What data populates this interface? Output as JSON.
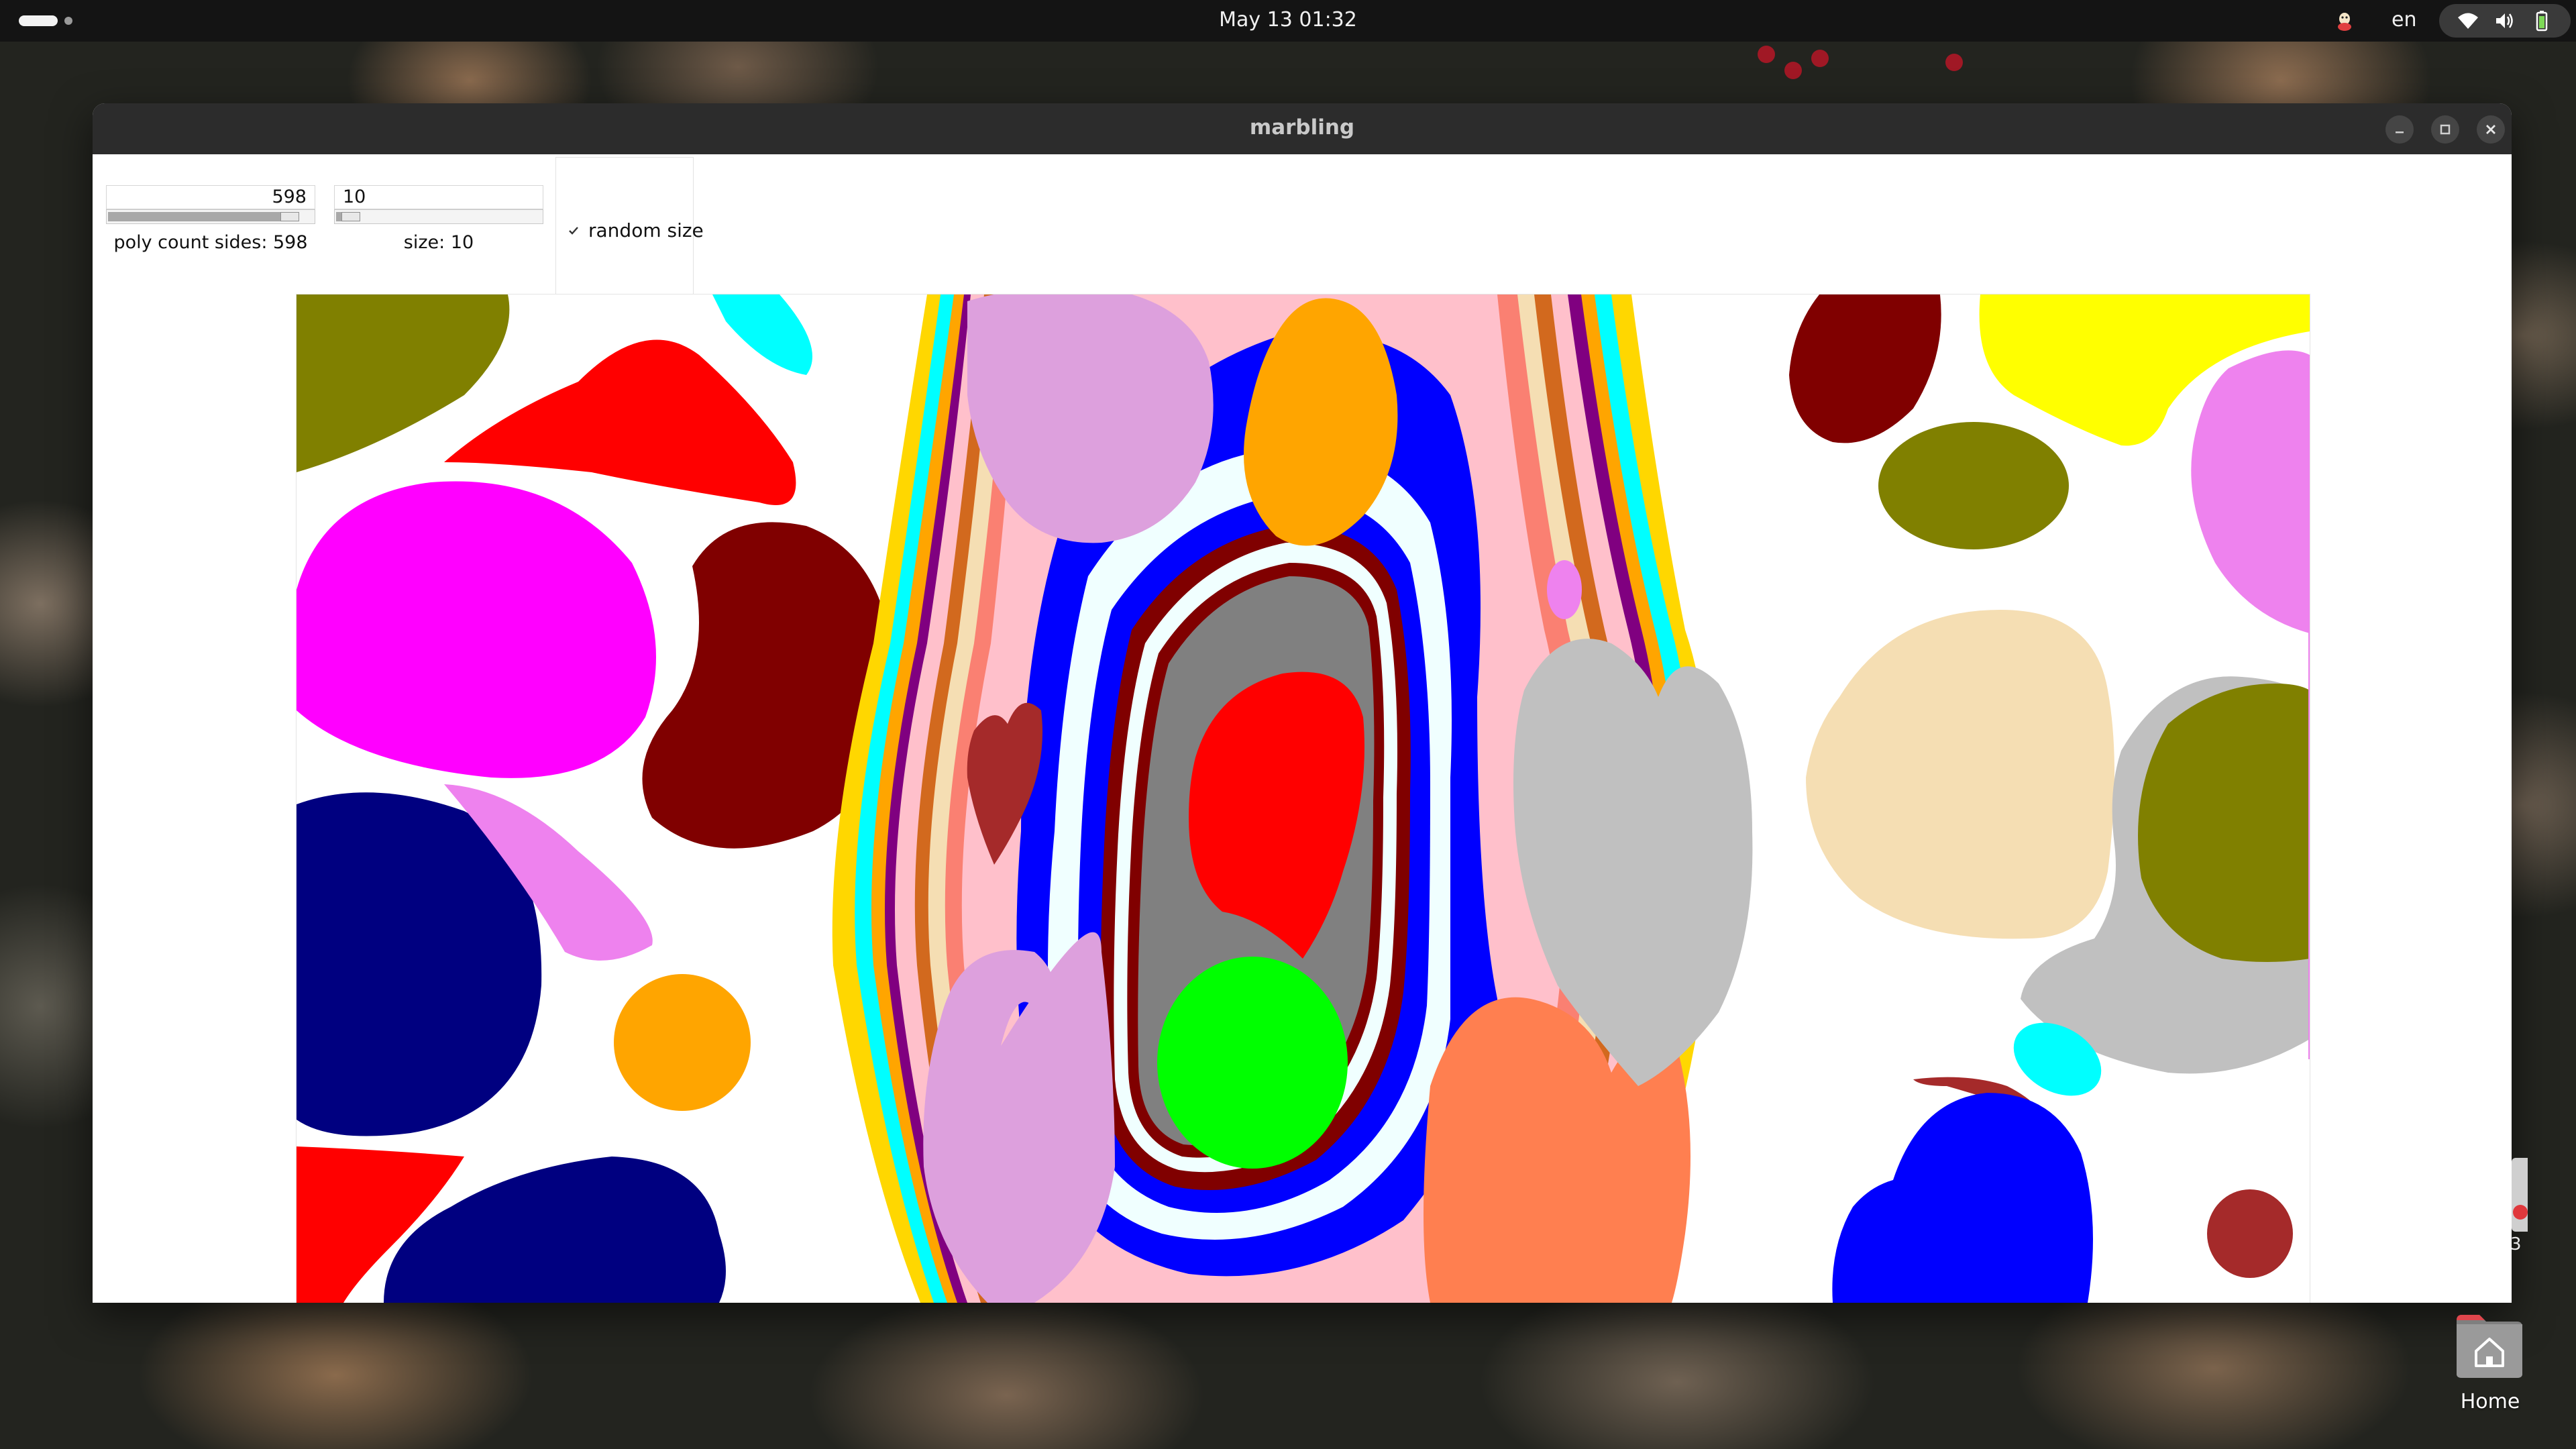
{
  "topbar": {
    "clock": "May 13  01:32",
    "language": "en",
    "icons": [
      "activities-icon",
      "app-indicator-icon",
      "wifi-icon",
      "volume-icon",
      "battery-icon"
    ]
  },
  "window": {
    "title": "marbling",
    "buttons": [
      "minimize-icon",
      "maximize-icon",
      "close-icon"
    ]
  },
  "controls": {
    "poly_count": {
      "value": "598",
      "caption": "poly count sides: 598",
      "level": 0.93
    },
    "size": {
      "value": "10",
      "caption": "size: 10",
      "level": 0.03
    },
    "random_size": {
      "label": "random size",
      "checked": true
    }
  },
  "canvas": {
    "background": "#ffffff",
    "palette": [
      "#808000",
      "#ff0000",
      "#00ffff",
      "#ff00ff",
      "#800000",
      "#000080",
      "#ee82ee",
      "#ffa500",
      "#dda0dd",
      "#0000ff",
      "#808080",
      "#00ff00",
      "#ff7f50",
      "#c0c0c0",
      "#ffff00",
      "#f5deb3",
      "#a52a2a",
      "#800080",
      "#ffc0cb",
      "#ffd700",
      "#fa8072",
      "#d2691e",
      "#f0ffff"
    ]
  },
  "desktop": {
    "home_label": "Home",
    "side_digit": "3"
  }
}
